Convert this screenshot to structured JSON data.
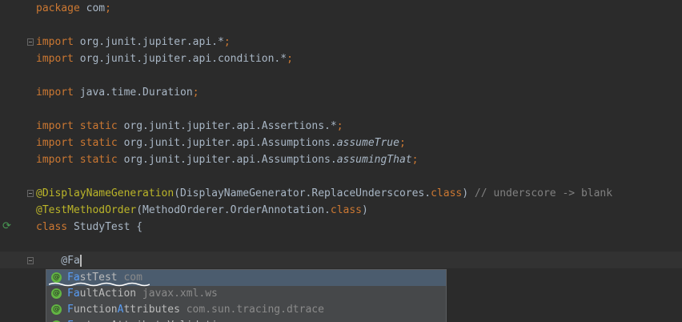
{
  "editor": {
    "lines": [
      {
        "parts": [
          {
            "t": "package",
            "c": "kw"
          },
          {
            "t": " com",
            "c": "plain"
          },
          {
            "t": ";",
            "c": "kw"
          }
        ]
      },
      {
        "parts": []
      },
      {
        "parts": [
          {
            "t": "import",
            "c": "kw"
          },
          {
            "t": " org.junit.jupiter.api.*",
            "c": "plain"
          },
          {
            "t": ";",
            "c": "kw"
          }
        ]
      },
      {
        "parts": [
          {
            "t": "import",
            "c": "kw"
          },
          {
            "t": " org.junit.jupiter.api.condition.*",
            "c": "plain"
          },
          {
            "t": ";",
            "c": "kw"
          }
        ]
      },
      {
        "parts": []
      },
      {
        "parts": [
          {
            "t": "import",
            "c": "kw"
          },
          {
            "t": " java.time.Duration",
            "c": "plain"
          },
          {
            "t": ";",
            "c": "kw"
          }
        ]
      },
      {
        "parts": []
      },
      {
        "parts": [
          {
            "t": "import static",
            "c": "kw"
          },
          {
            "t": " org.junit.jupiter.api.Assertions.*",
            "c": "plain"
          },
          {
            "t": ";",
            "c": "kw"
          }
        ]
      },
      {
        "parts": [
          {
            "t": "import static",
            "c": "kw"
          },
          {
            "t": " org.junit.jupiter.api.Assumptions.",
            "c": "plain"
          },
          {
            "t": "assumeTrue",
            "c": "it"
          },
          {
            "t": ";",
            "c": "kw"
          }
        ]
      },
      {
        "parts": [
          {
            "t": "import static",
            "c": "kw"
          },
          {
            "t": " org.junit.jupiter.api.Assumptions.",
            "c": "plain"
          },
          {
            "t": "assumingThat",
            "c": "it"
          },
          {
            "t": ";",
            "c": "kw"
          }
        ]
      },
      {
        "parts": []
      },
      {
        "parts": [
          {
            "t": "@DisplayNameGeneration",
            "c": "ann"
          },
          {
            "t": "(DisplayNameGenerator.ReplaceUnderscores.",
            "c": "plain"
          },
          {
            "t": "class",
            "c": "kw"
          },
          {
            "t": ") ",
            "c": "plain"
          },
          {
            "t": "// underscore -> blank",
            "c": "comment"
          }
        ]
      },
      {
        "parts": [
          {
            "t": "@TestMethodOrder",
            "c": "ann"
          },
          {
            "t": "(MethodOrderer.OrderAnnotation.",
            "c": "plain"
          },
          {
            "t": "class",
            "c": "kw"
          },
          {
            "t": ")",
            "c": "plain"
          }
        ]
      },
      {
        "parts": [
          {
            "t": "class",
            "c": "kw"
          },
          {
            "t": " StudyTest {",
            "c": "plain"
          }
        ]
      },
      {
        "parts": []
      },
      {
        "parts": [
          {
            "t": "    @Fa",
            "c": "plain"
          }
        ],
        "caret": true
      }
    ]
  },
  "autocomplete": {
    "items": [
      {
        "icon": "@",
        "match": "Fa",
        "rest": "stTest",
        "pkg": " com",
        "selected": true
      },
      {
        "icon": "@",
        "match": "Fa",
        "rest": "ultAction",
        "pkg": " javax.xml.ws",
        "selected": false
      },
      {
        "icon": "@",
        "match": "F",
        "rest": "unction",
        "match2": "A",
        "rest2": "ttributes",
        "pkg": " com.sun.tracing.dtrace",
        "selected": false
      },
      {
        "icon": "@",
        "match": "F",
        "rest": "eatureAttributeValidation",
        "pkg": " ...",
        "selected": false
      }
    ]
  },
  "colors": {
    "background": "#2b2b2b",
    "keyword": "#cc7832",
    "annotation": "#bbb529",
    "comment": "#808080",
    "match": "#589df6",
    "selected": "#4b5c6e"
  },
  "icons": {
    "run": "run-rerun-icon",
    "fold": "fold-marker-icon",
    "annotation": "annotation-type-icon"
  }
}
